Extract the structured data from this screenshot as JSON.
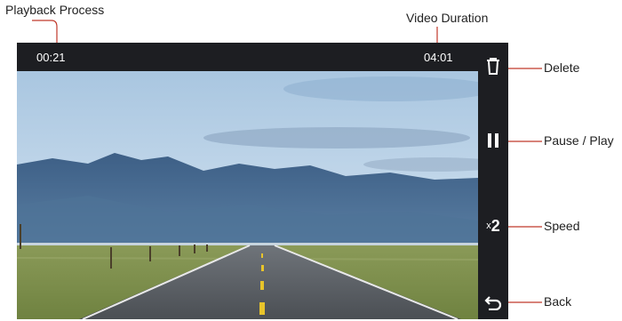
{
  "player": {
    "elapsed": "00:21",
    "duration": "04:01",
    "speed_prefix": "x",
    "speed_value": "2"
  },
  "callouts": {
    "playback_process": "Playback Process",
    "video_duration": "Video Duration",
    "delete": "Delete",
    "pause_play": "Pause / Play",
    "speed": "Speed",
    "back": "Back"
  },
  "icons": {
    "delete": "trash-icon",
    "pause": "pause-icon",
    "back": "back-arrow-icon"
  },
  "colors": {
    "chrome": "#1d1e22",
    "leader": "#c0392b"
  }
}
